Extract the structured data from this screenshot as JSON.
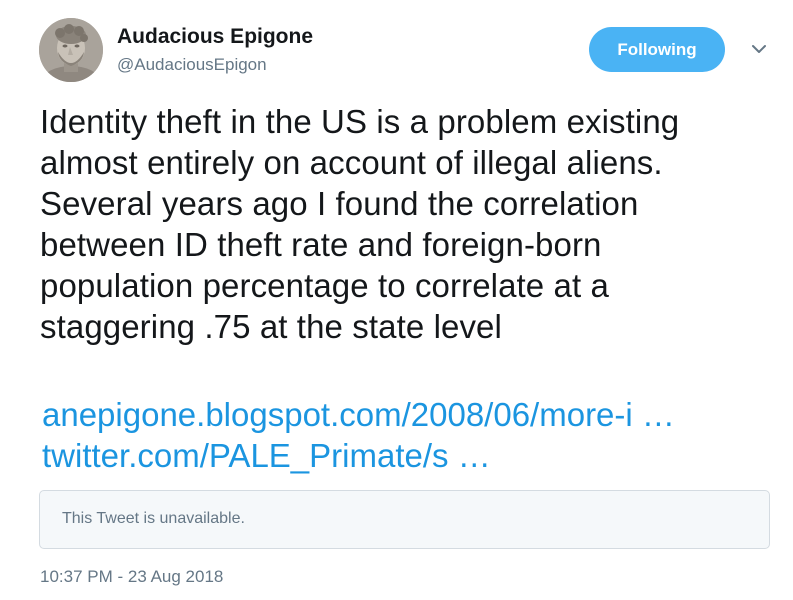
{
  "user": {
    "display_name": "Audacious Epigone",
    "handle": "@AudaciousEpigon",
    "avatar_icon": "marble-bust-avatar"
  },
  "follow_button": {
    "label": "Following",
    "color": "#4ab3f4"
  },
  "menu": {
    "icon": "chevron-down-icon"
  },
  "tweet": {
    "text": "Identity theft in the US is a problem existing\nalmost entirely on account of illegal aliens.\nSeveral years ago I found the correlation\nbetween ID theft rate and foreign-born\npopulation percentage to correlate at a\nstaggering .75 at the state level",
    "links": [
      "anepigone.blogspot.com/2008/06/more-i …",
      "twitter.com/PALE_Primate/s …"
    ],
    "link_color": "#1b95e0"
  },
  "quoted_tweet": {
    "text": "This Tweet is unavailable."
  },
  "timestamp": "10:37 PM - 23 Aug 2018"
}
